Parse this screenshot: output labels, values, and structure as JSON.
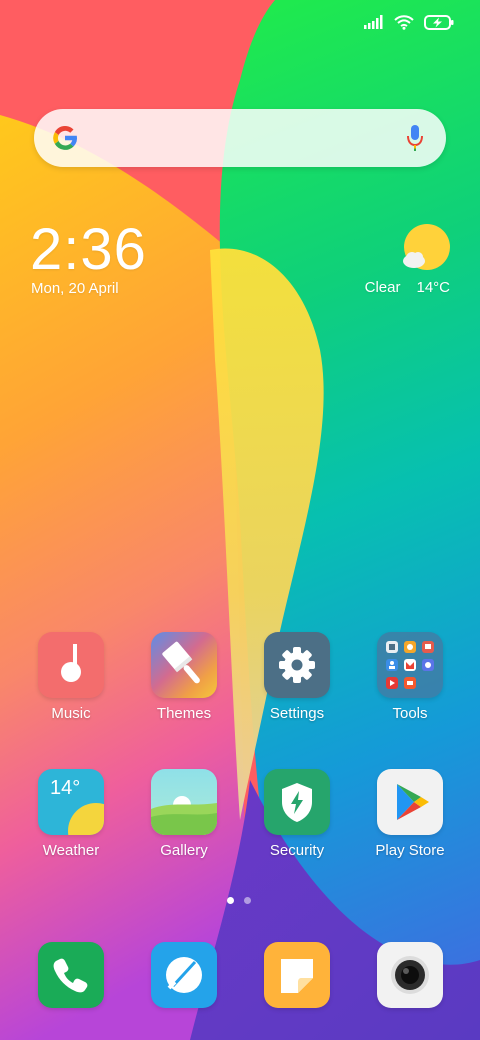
{
  "status_bar": {
    "icons": [
      "signal-icon",
      "wifi-icon",
      "battery-charging-icon"
    ]
  },
  "search": {
    "logo": "google-g-icon",
    "mic": "microphone-icon"
  },
  "clock": {
    "time": "2:36",
    "date": "Mon, 20 April"
  },
  "weather_widget": {
    "condition": "Clear",
    "temperature": "14°C",
    "icon": "sun-cloud-icon"
  },
  "apps": {
    "row1": [
      {
        "label": "Music",
        "icon": "music-note-icon"
      },
      {
        "label": "Themes",
        "icon": "paintbrush-icon"
      },
      {
        "label": "Settings",
        "icon": "gear-icon"
      },
      {
        "label": "Tools",
        "icon": "folder-icon"
      }
    ],
    "row2": [
      {
        "label": "Weather",
        "icon": "weather-icon",
        "badge": "14°"
      },
      {
        "label": "Gallery",
        "icon": "gallery-icon"
      },
      {
        "label": "Security",
        "icon": "shield-bolt-icon"
      },
      {
        "label": "Play Store",
        "icon": "play-store-icon"
      }
    ]
  },
  "dock": [
    {
      "icon": "phone-icon"
    },
    {
      "icon": "messages-icon"
    },
    {
      "icon": "notes-icon"
    },
    {
      "icon": "camera-icon"
    }
  ],
  "page_indicator": {
    "count": 2,
    "active": 1
  },
  "colors": {
    "music": "#f36d6d",
    "settings": "#4c6f86",
    "weather": "#2db5d8",
    "security": "#26a56c",
    "phone": "#1aab57",
    "messages": "#24a3ea",
    "notes": "#ffb33a",
    "camera": "#f2f2f2"
  }
}
